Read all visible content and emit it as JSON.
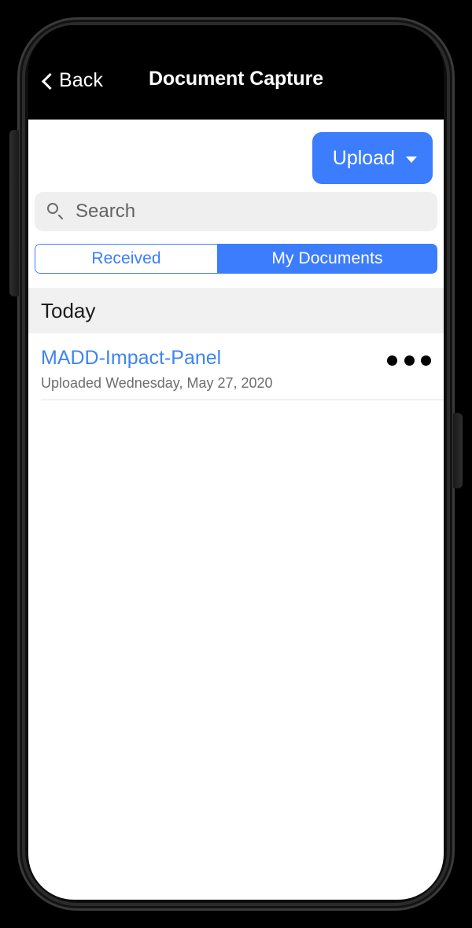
{
  "navbar": {
    "back_label": "Back",
    "back_icon": "chevron-left-icon",
    "title": "Document Capture"
  },
  "toolbar": {
    "upload_label": "Upload",
    "upload_caret_icon": "caret-down-icon"
  },
  "search": {
    "placeholder": "Search",
    "value": "",
    "icon": "search-icon"
  },
  "segmented_control": {
    "options": [
      {
        "label": "Received",
        "selected": false
      },
      {
        "label": "My Documents",
        "selected": true
      }
    ]
  },
  "section": {
    "title": "Today"
  },
  "documents": [
    {
      "title": "MADD-Impact-Panel",
      "subtitle": "Uploaded Wednesday, May 27, 2020",
      "more_icon": "more-horizontal-icon"
    }
  ],
  "colors": {
    "accent_blue": "#3b7dfd",
    "link_blue": "#3d85f0",
    "navbar_black": "#000000",
    "search_gray": "#efeff0",
    "section_gray": "#f1f1f1",
    "subtitle_gray": "#6d6d72"
  }
}
